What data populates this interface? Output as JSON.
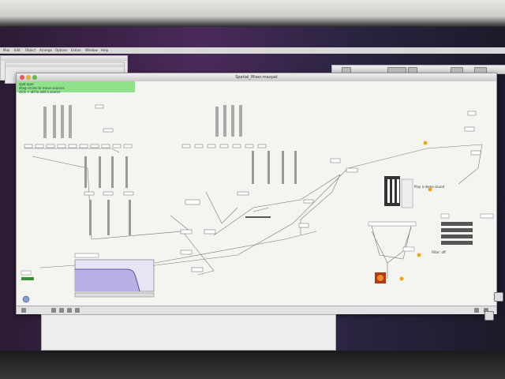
{
  "menubar": {
    "items": [
      "Max",
      "Edit",
      "Object",
      "Arrange",
      "Options",
      "Extras",
      "Window",
      "Help"
    ]
  },
  "window": {
    "title": "Spatial_Mixer.maxpat"
  },
  "green_header": {
    "line1": "spat.oper",
    "line2": "drag circles to move sources",
    "line3": "click + alt to add a source"
  },
  "panel": {
    "comment": "Play a demo sound",
    "status_text": "Filter: off"
  },
  "colors": {
    "accent_green": "#8fe28a",
    "filter_fill": "#b9b0e6",
    "orange_button": "#f4a316",
    "speaker": "#d9571c"
  }
}
